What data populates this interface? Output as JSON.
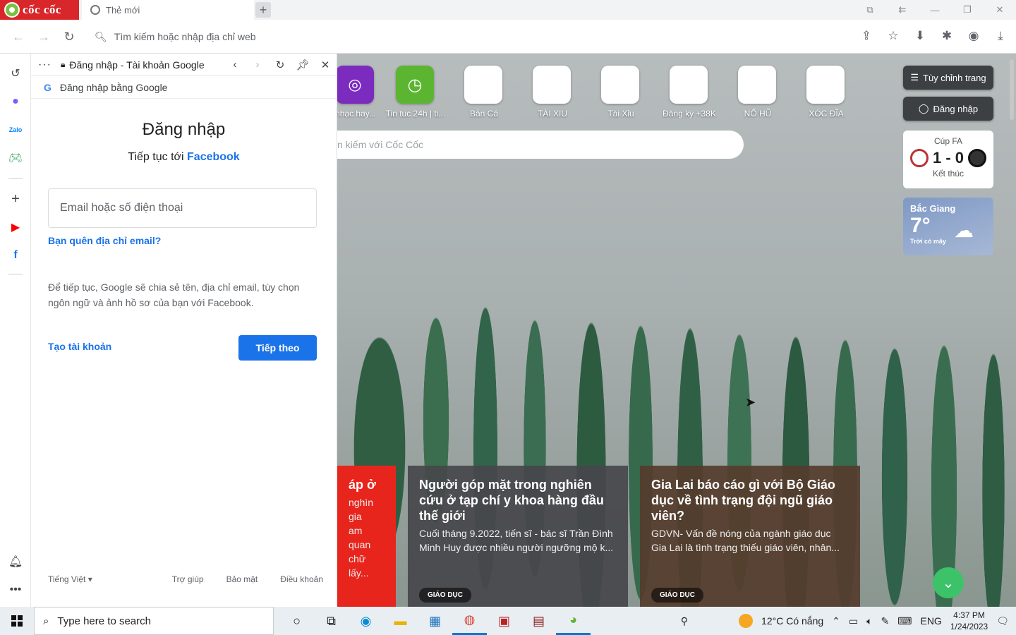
{
  "browser": {
    "brand": "cốc cốc",
    "tab_title": "Thẻ mới",
    "newtab_symbol": "+",
    "omnibox_placeholder": "Tìm kiếm hoặc nhập địa chỉ web",
    "window_controls": [
      "⧉",
      "⇇",
      "—",
      "❐",
      "✕"
    ],
    "toolbar_icons": [
      "share-icon",
      "star-icon",
      "download-box-icon",
      "extensions-icon",
      "profile-icon",
      "download-icon"
    ]
  },
  "sidepanel": {
    "title": "Đăng nhập - Tài khoản Google",
    "google_bar": "Đăng nhập bằng Google",
    "heading": "Đăng nhập",
    "continue_prefix": "Tiếp tục tới",
    "continue_target": "Facebook",
    "email_placeholder": "Email hoặc số điện thoại",
    "forgot_email": "Bạn quên địa chỉ email?",
    "notice": "Để tiếp tục, Google sẽ chia sẻ tên, địa chỉ email, tùy chọn ngôn ngữ và ảnh hồ sơ của bạn với Facebook.",
    "create_account": "Tạo tài khoản",
    "next_button": "Tiếp theo",
    "language": "Tiếng Việt",
    "footer_links": [
      "Trợ giúp",
      "Bảo mật",
      "Điều khoản"
    ]
  },
  "newtab": {
    "shortcuts": [
      "nhạc hay...",
      "Tin tuc 24h | ti...",
      "Bắn Cá",
      "TÀI XIU",
      "Tài Xỉu",
      "Đăng ký +38K",
      "NỔ HŨ",
      "XÓC ĐĨA"
    ],
    "search_placeholder": "n kiếm với Cốc Cốc",
    "customize_button": "Tùy chỉnh trang",
    "login_button": "Đăng nhập",
    "score": {
      "competition": "Cúp FA",
      "result": "1 - 0",
      "status": "Kết thúc"
    },
    "weather": {
      "city": "Bắc Giang",
      "temp": "7°",
      "desc": "Trời có mây"
    },
    "news": [
      {
        "title": "áp ở",
        "summary": "nghìn gia\nam quan\nchữ lấy...",
        "tag": ""
      },
      {
        "title": "Người góp mặt trong nghiên cứu ở tạp chí y khoa hàng đầu thế giới",
        "summary": "Cuối tháng 9.2022, tiến sĩ - bác sĩ Trần Đình Minh Huy được nhiều người ngưỡng mộ k...",
        "tag": "GIÁO DỤC"
      },
      {
        "title": "Gia Lai báo cáo gì với Bộ Giáo dục về tình trạng đội ngũ giáo viên?",
        "summary": "GDVN- Vấn đề nóng của ngành giáo dục Gia Lai là tình trạng thiếu giáo viên, nhân...",
        "tag": "GIÁO DỤC"
      }
    ]
  },
  "taskbar": {
    "search_placeholder": "Type here to search",
    "weather_text": "12°C  Có nắng",
    "lang": "ENG",
    "time": "4:37 PM",
    "date": "1/24/2023"
  }
}
